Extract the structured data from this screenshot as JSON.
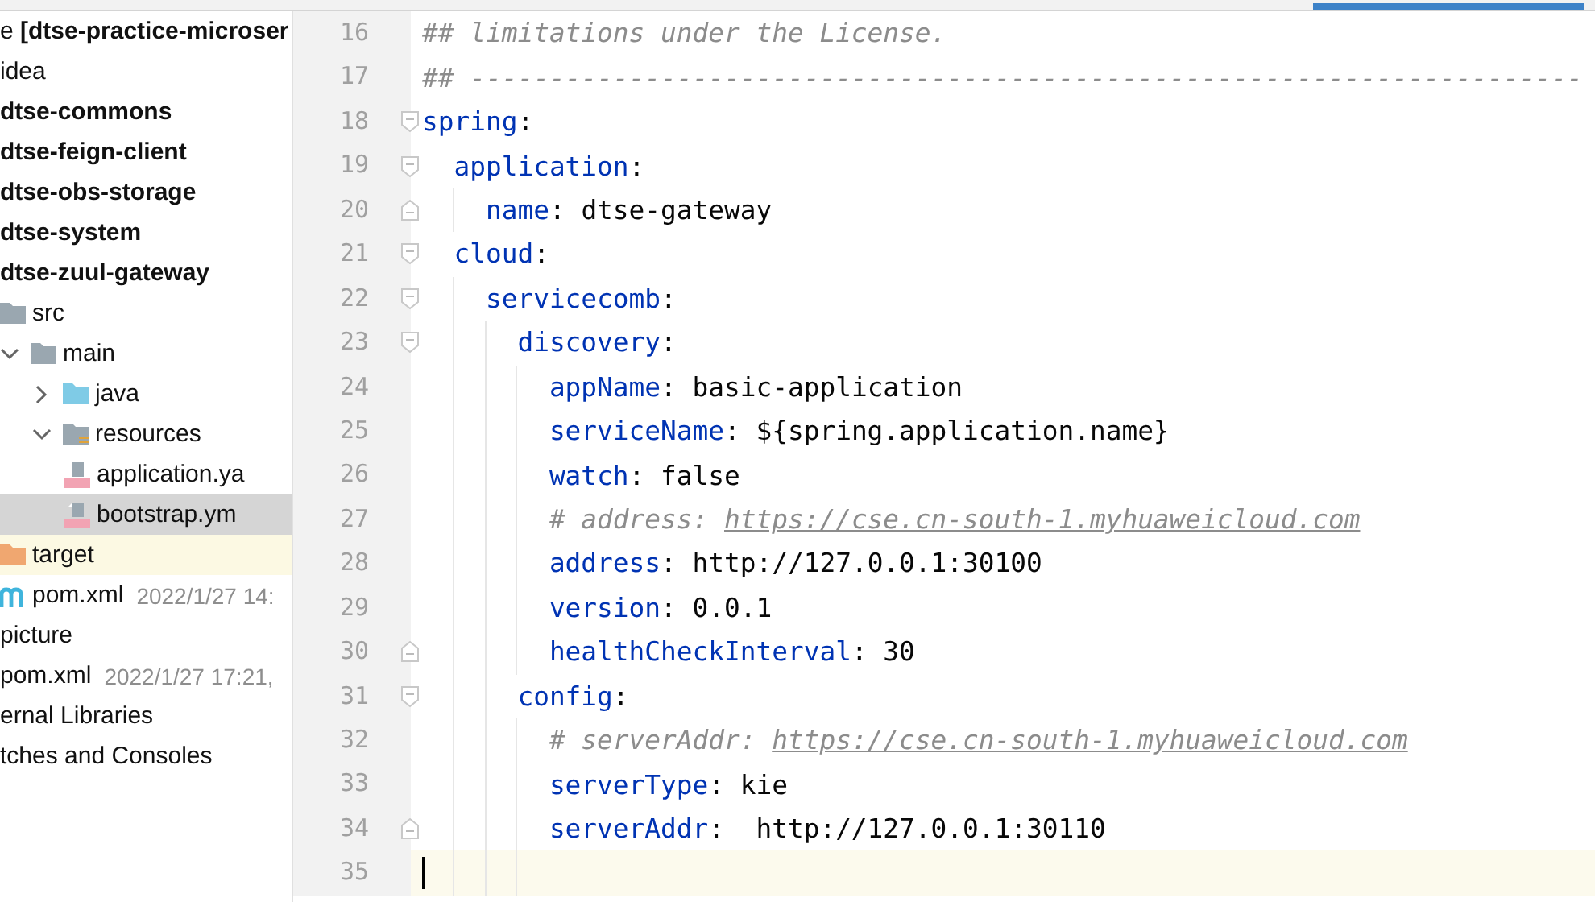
{
  "project_tree": [
    {
      "label": "e **[dtse-practice-microser**",
      "selected": false,
      "highlighted": false
    },
    {
      "label": "idea",
      "selected": false,
      "highlighted": false
    },
    {
      "label": "dtse-commons",
      "bold": true,
      "selected": false,
      "highlighted": false
    },
    {
      "label": "dtse-feign-client",
      "bold": true,
      "selected": false,
      "highlighted": false
    },
    {
      "label": "dtse-obs-storage",
      "bold": true,
      "selected": false,
      "highlighted": false
    },
    {
      "label": "dtse-system",
      "bold": true,
      "selected": false,
      "highlighted": false
    },
    {
      "label": "dtse-zuul-gateway",
      "bold": true,
      "selected": false,
      "highlighted": false,
      "children": [
        {
          "label": "src",
          "kind": "folder",
          "selected": false,
          "highlighted": false,
          "children": [
            {
              "label": "main",
              "kind": "folder",
              "expanded": true,
              "selected": false,
              "highlighted": false,
              "children": [
                {
                  "label": "java",
                  "kind": "source-folder",
                  "expanded": false,
                  "selected": false,
                  "highlighted": false
                },
                {
                  "label": "resources",
                  "kind": "resource-folder",
                  "expanded": true,
                  "selected": false,
                  "highlighted": false,
                  "children": [
                    {
                      "label": "application.ya",
                      "kind": "yml",
                      "selected": false,
                      "highlighted": false
                    },
                    {
                      "label": "bootstrap.ym",
                      "kind": "yml",
                      "selected": true,
                      "highlighted": false
                    }
                  ]
                }
              ]
            }
          ]
        },
        {
          "label": "target",
          "kind": "excluded-folder",
          "selected": false,
          "highlighted": true
        },
        {
          "label": "pom.xml",
          "kind": "maven",
          "date": "2022/1/27 14:",
          "selected": false,
          "highlighted": false
        }
      ]
    },
    {
      "label": "picture",
      "selected": false,
      "highlighted": false
    },
    {
      "label": "pom.xml",
      "date": "2022/1/27 17:21,",
      "selected": false,
      "highlighted": false
    },
    {
      "label": "ernal Libraries",
      "selected": false,
      "highlighted": false
    },
    {
      "label": "tches and Consoles",
      "selected": false,
      "highlighted": false
    }
  ],
  "editor": {
    "lines": [
      {
        "number": "16",
        "segments": [
          {
            "kind": "comment",
            "text": "## limitations under the License."
          }
        ]
      },
      {
        "number": "17",
        "segments": [
          {
            "kind": "comment",
            "text": "## ----------------------------------------------------------------------"
          }
        ]
      },
      {
        "number": "18",
        "fold_start": true,
        "segments": [
          {
            "kind": "key",
            "text": "spring"
          },
          {
            "kind": "plain",
            "text": ":"
          }
        ]
      },
      {
        "number": "19",
        "fold_start": true,
        "segments": [
          {
            "kind": "key",
            "text": "  application"
          },
          {
            "kind": "plain",
            "text": ":"
          }
        ]
      },
      {
        "number": "20",
        "fold_end": true,
        "segments": [
          {
            "kind": "key",
            "text": "    name"
          },
          {
            "kind": "plain",
            "text": ": dtse-gateway"
          }
        ]
      },
      {
        "number": "21",
        "fold_start": true,
        "segments": [
          {
            "kind": "key",
            "text": "  cloud"
          },
          {
            "kind": "plain",
            "text": ":"
          }
        ]
      },
      {
        "number": "22",
        "fold_start": true,
        "segments": [
          {
            "kind": "key",
            "text": "    servicecomb"
          },
          {
            "kind": "plain",
            "text": ":"
          }
        ]
      },
      {
        "number": "23",
        "fold_start": true,
        "segments": [
          {
            "kind": "key",
            "text": "      discovery"
          },
          {
            "kind": "plain",
            "text": ":"
          }
        ]
      },
      {
        "number": "24",
        "segments": [
          {
            "kind": "key",
            "text": "        appName"
          },
          {
            "kind": "plain",
            "text": ": basic-application"
          }
        ]
      },
      {
        "number": "25",
        "segments": [
          {
            "kind": "key",
            "text": "        serviceName"
          },
          {
            "kind": "plain",
            "text": ": ${spring.application.name}"
          }
        ]
      },
      {
        "number": "26",
        "segments": [
          {
            "kind": "key",
            "text": "        watch"
          },
          {
            "kind": "plain",
            "text": ": false"
          }
        ]
      },
      {
        "number": "27",
        "segments": [
          {
            "kind": "comment",
            "text": "        # address: "
          },
          {
            "kind": "link",
            "text": "https://cse.cn-south-1.myhuaweicloud.com"
          }
        ]
      },
      {
        "number": "28",
        "segments": [
          {
            "kind": "key",
            "text": "        address"
          },
          {
            "kind": "plain",
            "text": ": http://127.0.0.1:30100"
          }
        ]
      },
      {
        "number": "29",
        "segments": [
          {
            "kind": "key",
            "text": "        version"
          },
          {
            "kind": "plain",
            "text": ": 0.0.1"
          }
        ]
      },
      {
        "number": "30",
        "fold_end": true,
        "segments": [
          {
            "kind": "key",
            "text": "        healthCheckInterval"
          },
          {
            "kind": "plain",
            "text": ": 30"
          }
        ]
      },
      {
        "number": "31",
        "fold_start": true,
        "segments": [
          {
            "kind": "key",
            "text": "      config"
          },
          {
            "kind": "plain",
            "text": ":"
          }
        ]
      },
      {
        "number": "32",
        "segments": [
          {
            "kind": "comment",
            "text": "        # serverAddr: "
          },
          {
            "kind": "link",
            "text": "https://cse.cn-south-1.myhuaweicloud.com"
          }
        ]
      },
      {
        "number": "33",
        "segments": [
          {
            "kind": "key",
            "text": "        serverType"
          },
          {
            "kind": "plain",
            "text": ": kie"
          }
        ]
      },
      {
        "number": "34",
        "fold_end": true,
        "segments": [
          {
            "kind": "key",
            "text": "        serverAddr"
          },
          {
            "kind": "plain",
            "text": ":  http://127.0.0.1:30110"
          }
        ]
      },
      {
        "number": "35",
        "current": true
      }
    ]
  }
}
